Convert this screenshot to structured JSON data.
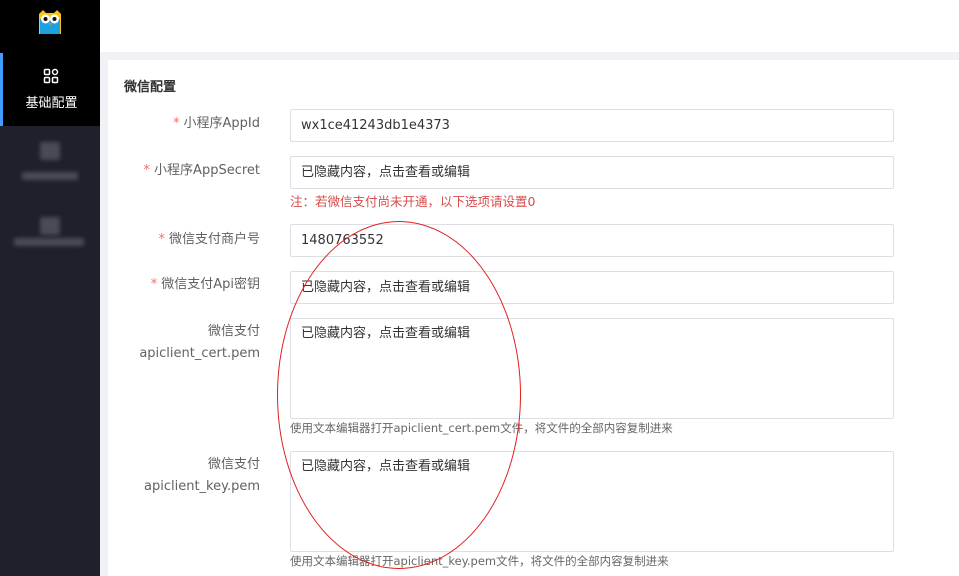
{
  "sidebar": {
    "logo_icon": "owl-logo-icon",
    "active_item": {
      "label": "基础配置",
      "icon": "grid-icon"
    },
    "blurred_items": [
      "",
      ""
    ]
  },
  "panel": {
    "title": "微信配置",
    "fields": {
      "appid": {
        "label": "小程序AppId",
        "required": "*",
        "value": "wx1ce41243db1e4373"
      },
      "appsecret": {
        "label": "小程序AppSecret",
        "required": "*",
        "value": "已隐藏内容，点击查看或编辑"
      },
      "mchid": {
        "label": "微信支付商户号",
        "required": "*",
        "value": "1480763552"
      },
      "apikey": {
        "label": "微信支付Api密钥",
        "required": "*",
        "value": "已隐藏内容，点击查看或编辑"
      },
      "cert": {
        "label_line1": "微信支付",
        "label_line2": "apiclient_cert.pem",
        "value": "已隐藏内容，点击查看或编辑",
        "hint": "使用文本编辑器打开apiclient_cert.pem文件，将文件的全部内容复制进来"
      },
      "key": {
        "label_line1": "微信支付",
        "label_line2": "apiclient_key.pem",
        "value": "已隐藏内容，点击查看或编辑",
        "hint": "使用文本编辑器打开apiclient_key.pem文件，将文件的全部内容复制进来"
      }
    },
    "warning": "注：若微信支付尚未开通，以下选项请设置0"
  },
  "colors": {
    "accent": "#409eff",
    "required": "#f56c6c",
    "warning": "#d94b4b",
    "annotation": "#e02020"
  }
}
